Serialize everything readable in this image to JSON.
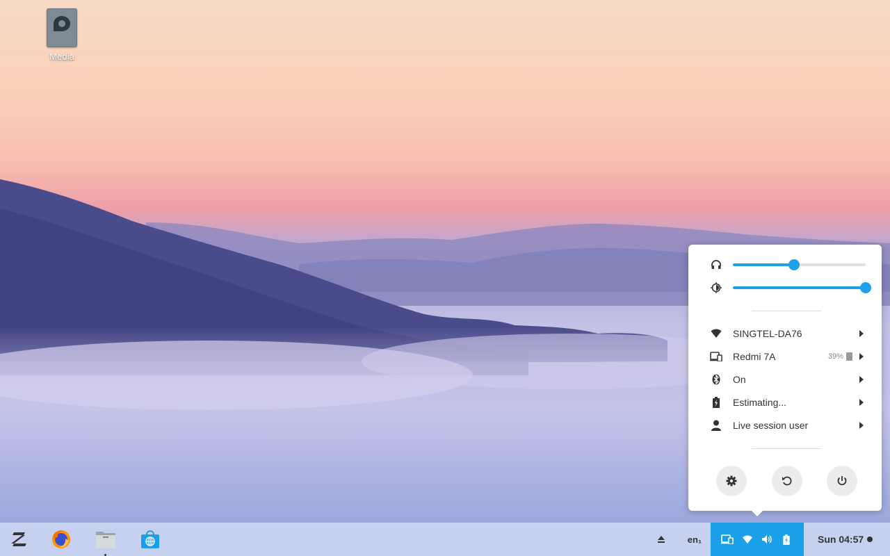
{
  "desktop": {
    "icons": [
      {
        "label": "Media",
        "icon": "drive-icon"
      }
    ]
  },
  "popup": {
    "sliders": {
      "volume": {
        "icon": "headphones-icon",
        "level": 0.46
      },
      "brightness": {
        "icon": "brightness-icon",
        "level": 1.0
      }
    },
    "items": [
      {
        "label": "SINGTEL-DA76",
        "icon": "wifi-icon"
      },
      {
        "label": "Redmi 7A",
        "icon": "phone-device-icon",
        "extra": "39%"
      },
      {
        "label": "On",
        "icon": "bluetooth-icon"
      },
      {
        "label": "Estimating...",
        "icon": "battery-charging-icon"
      },
      {
        "label": "Live session user",
        "icon": "user-icon"
      }
    ],
    "actions": [
      {
        "icon": "settings-gear-icon"
      },
      {
        "icon": "restart-icon"
      },
      {
        "icon": "power-icon"
      }
    ]
  },
  "taskbar": {
    "lang": "en₁",
    "clock": "Sun 04:57",
    "launchers": [
      "zorin-menu-icon",
      "firefox-icon",
      "files-icon",
      "software-store-icon"
    ],
    "tray_color": "#1b9fe8",
    "accent": "#1fa1ea"
  }
}
